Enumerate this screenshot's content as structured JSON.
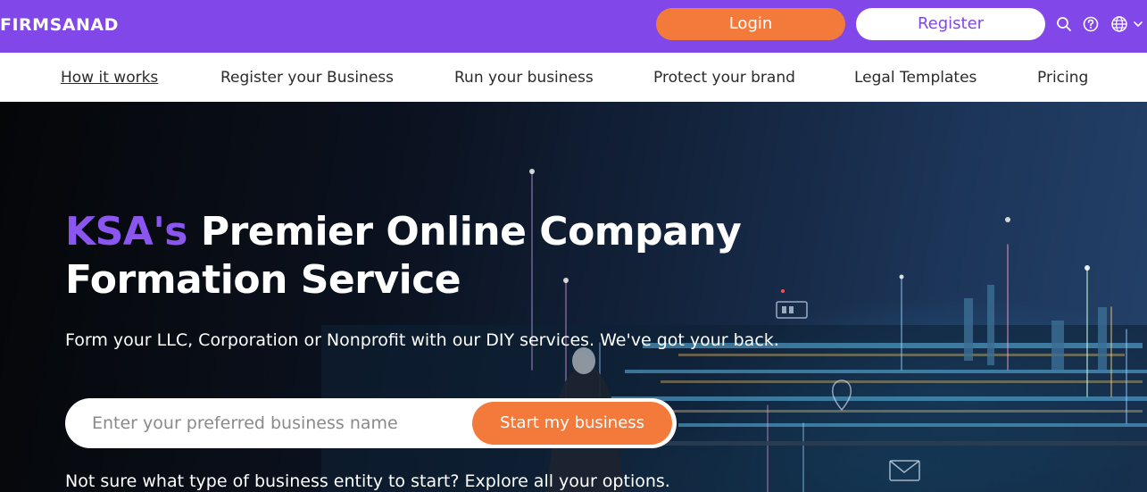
{
  "header": {
    "logo_text": "FIRMSANAD",
    "login_label": "Login",
    "register_label": "Register",
    "icons": [
      "search-icon",
      "help-icon",
      "globe-icon",
      "chevron-down-icon"
    ]
  },
  "nav": {
    "items": [
      {
        "label": "How it works",
        "active": true
      },
      {
        "label": "Register your Business"
      },
      {
        "label": "Run your business"
      },
      {
        "label": "Protect your brand"
      },
      {
        "label": "Legal Templates"
      },
      {
        "label": "Pricing"
      }
    ]
  },
  "hero": {
    "title_accent": "KSA's",
    "title_rest": "Premier Online Company",
    "title_line2": "Formation Service",
    "subtitle": "Form your LLC, Corporation or Nonprofit with our DIY services. We've got your back.",
    "search_placeholder": "Enter your preferred business name",
    "start_button_label": "Start my business",
    "explore_text": "Not sure what type of business entity to start? Explore all your options."
  },
  "colors": {
    "brand_purple": "#8247e9",
    "accent_orange": "#f47a3c",
    "title_accent_purple": "#8b55f0"
  }
}
